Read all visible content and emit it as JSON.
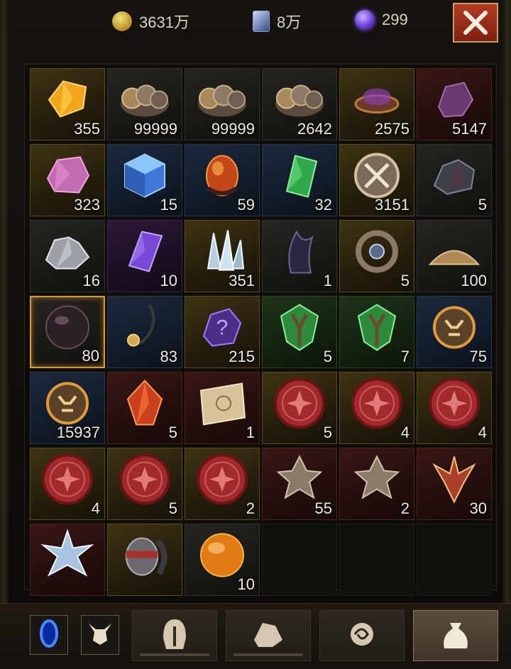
{
  "currency": {
    "gold": {
      "icon": "gold-coin-icon",
      "value": "3631万"
    },
    "scroll": {
      "icon": "scroll-icon",
      "value": "8万"
    },
    "orb": {
      "icon": "purple-orb-icon",
      "value": "299"
    }
  },
  "close_icon": "close-icon",
  "slots": [
    {
      "icon": "amber-crystal-icon",
      "qty": "355",
      "rarity": "gold"
    },
    {
      "icon": "rune-coins-icon",
      "qty": "99999",
      "rarity": "gray"
    },
    {
      "icon": "rune-coins-icon",
      "qty": "99999",
      "rarity": "gray"
    },
    {
      "icon": "rune-coins-icon",
      "qty": "2642",
      "rarity": "gray"
    },
    {
      "icon": "purple-bowl-icon",
      "qty": "2575",
      "rarity": "gold"
    },
    {
      "icon": "purple-ore-icon",
      "qty": "5147",
      "rarity": "red"
    },
    {
      "icon": "pink-ore-icon",
      "qty": "323",
      "rarity": "gold"
    },
    {
      "icon": "blue-cube-icon",
      "qty": "15",
      "rarity": "blue"
    },
    {
      "icon": "fire-egg-icon",
      "qty": "59",
      "rarity": "blue"
    },
    {
      "icon": "green-crystal-icon",
      "qty": "32",
      "rarity": "blue"
    },
    {
      "icon": "crossed-swords-medal-icon",
      "qty": "3151",
      "rarity": "gold"
    },
    {
      "icon": "dark-ore-icon",
      "qty": "5",
      "rarity": "gray"
    },
    {
      "icon": "silver-ore-icon",
      "qty": "16",
      "rarity": "gray"
    },
    {
      "icon": "violet-crystal-icon",
      "qty": "10",
      "rarity": "purple"
    },
    {
      "icon": "ice-shards-icon",
      "qty": "351",
      "rarity": "gold"
    },
    {
      "icon": "dark-horn-icon",
      "qty": "1",
      "rarity": "gray"
    },
    {
      "icon": "rune-ring-icon",
      "qty": "5",
      "rarity": "gold"
    },
    {
      "icon": "sand-pile-icon",
      "qty": "100",
      "rarity": "gray"
    },
    {
      "icon": "dark-sphere-icon",
      "qty": "80",
      "rarity": "selected"
    },
    {
      "icon": "fishing-hook-icon",
      "qty": "83",
      "rarity": "blue"
    },
    {
      "icon": "mystery-stone-icon",
      "qty": "215",
      "rarity": "gold"
    },
    {
      "icon": "green-relic-icon",
      "qty": "5",
      "rarity": "green"
    },
    {
      "icon": "green-relic-icon",
      "qty": "7",
      "rarity": "green"
    },
    {
      "icon": "demon-medallion-icon",
      "qty": "75",
      "rarity": "blue"
    },
    {
      "icon": "demon-medallion-icon",
      "qty": "15937",
      "rarity": "blue"
    },
    {
      "icon": "fire-crystal-icon",
      "qty": "5",
      "rarity": "red"
    },
    {
      "icon": "treasure-map-icon",
      "qty": "1",
      "rarity": "red"
    },
    {
      "icon": "red-seal-icon",
      "qty": "5",
      "rarity": "gold"
    },
    {
      "icon": "red-seal-icon",
      "qty": "4",
      "rarity": "gold"
    },
    {
      "icon": "red-seal-icon",
      "qty": "4",
      "rarity": "gold"
    },
    {
      "icon": "red-seal-icon",
      "qty": "4",
      "rarity": "gold"
    },
    {
      "icon": "red-seal-icon",
      "qty": "5",
      "rarity": "gold"
    },
    {
      "icon": "red-seal-icon",
      "qty": "2",
      "rarity": "gold"
    },
    {
      "icon": "spiked-relic-icon",
      "qty": "55",
      "rarity": "red"
    },
    {
      "icon": "spiked-relic-icon",
      "qty": "2",
      "rarity": "red"
    },
    {
      "icon": "flame-relic-icon",
      "qty": "30",
      "rarity": "red"
    },
    {
      "icon": "frost-flower-icon",
      "qty": "",
      "rarity": "red"
    },
    {
      "icon": "masked-head-icon",
      "qty": "",
      "rarity": "gold"
    },
    {
      "icon": "orange-orb-icon",
      "qty": "10",
      "rarity": "gray"
    },
    {
      "icon": "",
      "qty": "",
      "rarity": "empty"
    },
    {
      "icon": "",
      "qty": "",
      "rarity": "empty"
    },
    {
      "icon": "",
      "qty": "",
      "rarity": "empty"
    }
  ],
  "bottom_tabs": [
    {
      "icon": "blue-portal-icon",
      "kind": "small"
    },
    {
      "icon": "demon-head-icon",
      "kind": "small"
    },
    {
      "icon": "helmet-icon",
      "kind": "wide"
    },
    {
      "icon": "ore-chunk-icon",
      "kind": "wide"
    },
    {
      "icon": "swirl-rune-icon",
      "kind": "wide"
    },
    {
      "icon": "bag-icon",
      "kind": "wide",
      "active": true
    }
  ]
}
